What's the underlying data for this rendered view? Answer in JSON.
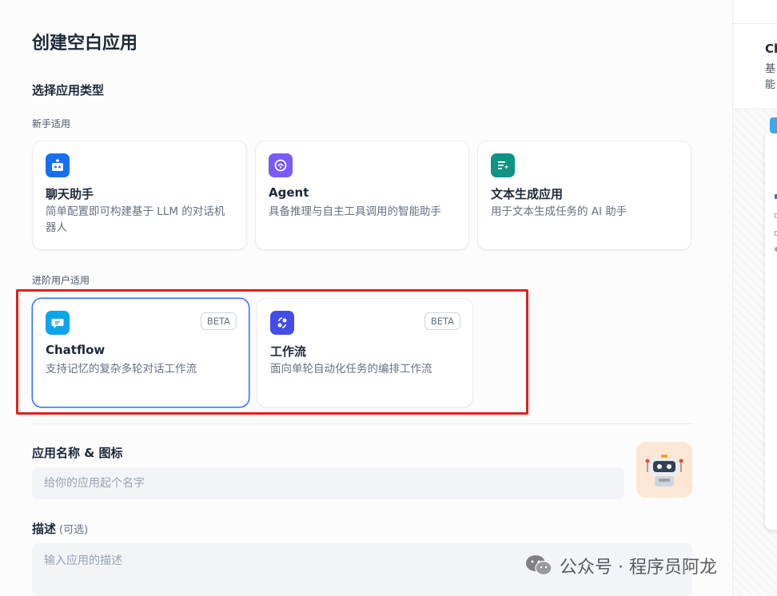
{
  "page": {
    "title": "创建空白应用"
  },
  "app_type": {
    "section_label": "选择应用类型",
    "beginner_label": "新手适用",
    "advanced_label": "进阶用户适用",
    "beginner_cards": [
      {
        "title": "聊天助手",
        "desc": "简单配置即可构建基于 LLM 的对话机器人",
        "icon": "robot-chat-icon",
        "color": "#1570ef"
      },
      {
        "title": "Agent",
        "desc": "具备推理与自主工具调用的智能助手",
        "icon": "agent-brain-icon",
        "color": "#7a5af8"
      },
      {
        "title": "文本生成应用",
        "desc": "用于文本生成任务的 AI 助手",
        "icon": "text-sparkle-icon",
        "color": "#0e9384"
      }
    ],
    "advanced_cards": [
      {
        "title": "Chatflow",
        "desc": "支持记忆的复杂多轮对话工作流",
        "icon": "chat-bubble-icon",
        "color": "#0ba5ec",
        "badge": "BETA"
      },
      {
        "title": "工作流",
        "desc": "面向单轮自动化任务的编排工作流",
        "icon": "workflow-nodes-icon",
        "color": "#444ce7",
        "badge": "BETA"
      }
    ]
  },
  "form": {
    "name_label": "应用名称 & 图标",
    "name_placeholder": "给你的应用起个名字",
    "name_value": "",
    "desc_label": "描述",
    "desc_optional": "(可选)",
    "desc_placeholder": "输入应用的描述",
    "avatar_icon": "robot-avatar-icon"
  },
  "side_panel": {
    "title": "Ch",
    "desc_line1": "基",
    "desc_line2": "能"
  },
  "watermark": {
    "text": "公众号 · 程序员阿龙",
    "icon": "wechat-icon"
  },
  "colors": {
    "highlight": "#e0201b",
    "selected_border": "#2970ff"
  }
}
